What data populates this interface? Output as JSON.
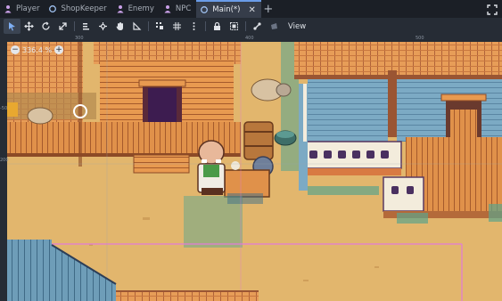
{
  "tabs": [
    {
      "label": "Player",
      "icon": "person-icon",
      "active": false
    },
    {
      "label": "ShopKeeper",
      "icon": "node2d-icon",
      "active": false
    },
    {
      "label": "Enemy",
      "icon": "person-icon",
      "active": false
    },
    {
      "label": "NPC",
      "icon": "person-icon",
      "active": false
    },
    {
      "label": "Main(*)",
      "icon": "node2d-icon",
      "active": true
    }
  ],
  "toolbar": {
    "view_label": "View"
  },
  "viewport": {
    "zoom_label": "336.4 %",
    "ruler_ticks_top": [
      "300",
      "400",
      "500"
    ],
    "ruler_ticks_left": [
      "-50",
      "200"
    ]
  },
  "colors": {
    "accent": "#6a9ce8",
    "tab_bg": "#1b1f26",
    "toolbar_bg": "#262c35",
    "ground": "#e2b66d",
    "wood": "#e0914a",
    "wood_dark": "#a55a2c",
    "building_wall": "#7caac4",
    "roof_trim": "#9a5533"
  }
}
